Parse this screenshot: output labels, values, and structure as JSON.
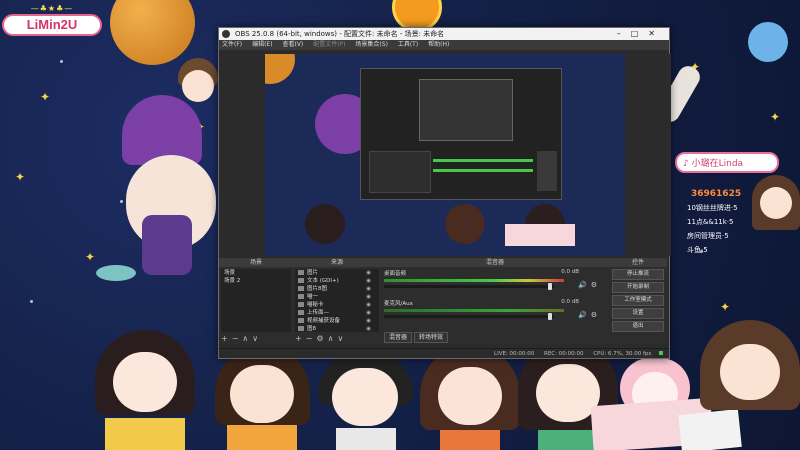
{
  "overlay": {
    "brand_top": "—♣★♣—",
    "brand_name": "LiMin2U",
    "side_title": "♪ 小璐在Linda",
    "side_number": "36961625",
    "side_line1": "10钢丝丝牌进·5",
    "side_line2": "11点&&11k·5",
    "side_line3": "房间管理员·5",
    "side_line4": "斗鱼·5"
  },
  "obs": {
    "title": "OBS 25.0.8 (64-bit, windows) - 配置文件: 未命名 - 场景: 未命名",
    "menu": [
      "文件(F)",
      "编辑(E)",
      "查看(V)",
      "配置文件(P)",
      "场景集合(S)",
      "工具(T)",
      "帮助(H)"
    ],
    "scenes_title": "场景",
    "scenes": [
      "场景",
      "场景 2"
    ],
    "sources_title": "来源",
    "sources": [
      "图片",
      "文本 (GDI+)",
      "图片8图",
      "喵一",
      "喵秘卡",
      "上传面—",
      "视频捕获设备",
      "图8"
    ],
    "mixer_title": "混音器",
    "mixer": [
      {
        "name": "桌面音频",
        "db": "0.0 dB"
      },
      {
        "name": "麦克风/Aux",
        "db": "0.0 dB"
      }
    ],
    "mixer_tabs": [
      "混音器",
      "转场特效"
    ],
    "controls_title": "控件",
    "controls": [
      "停止推流",
      "开始录制",
      "工作室模式",
      "设置",
      "退出"
    ],
    "status": {
      "live": "LIVE: 00:00:00",
      "rec": "REC: 00:00:00",
      "cpu": "CPU: 6.7%, 30.00 fps"
    }
  }
}
